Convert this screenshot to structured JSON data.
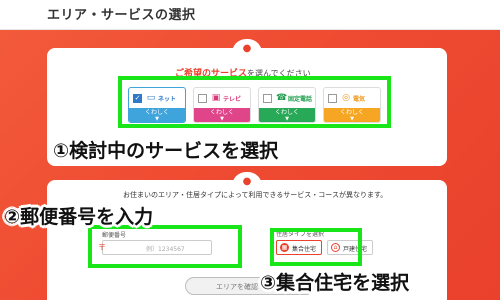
{
  "page": {
    "title": "エリア・サービスの選択"
  },
  "services": {
    "prompt": "ご希望のサービス",
    "prompt_tail": "を選んでください",
    "details_label": "くわしく",
    "items": [
      {
        "label": "ネット",
        "checked": true,
        "color": "#3fa3dc",
        "icon": "computer-icon"
      },
      {
        "label": "テレビ",
        "checked": false,
        "color": "#e0458a",
        "icon": "tv-icon"
      },
      {
        "label": "固定電話",
        "checked": false,
        "color": "#28a958",
        "icon": "phone-icon"
      },
      {
        "label": "電気",
        "checked": false,
        "color": "#f6a623",
        "icon": "lightbulb-icon"
      }
    ]
  },
  "address": {
    "prompt": "お住まいのエリア・住居タイプによって利用できるサービス・コースが異なります。",
    "postal_label": "郵便番号",
    "postal_mark": "〒",
    "postal_placeholder": "例）1234567",
    "postal_value": "",
    "housing_label": "住居タイプを選択",
    "housing_options": [
      {
        "label": "集合住宅",
        "selected": true
      },
      {
        "label": "戸建住宅",
        "selected": false
      }
    ],
    "submit_label": "エリアを確認"
  },
  "annotations": {
    "step1": "①検討中のサービスを選択",
    "step2": "②郵便番号を入力",
    "step3": "③集合住宅を選択"
  },
  "colors": {
    "brand": "#ef4b32",
    "highlight": "#19e619"
  }
}
